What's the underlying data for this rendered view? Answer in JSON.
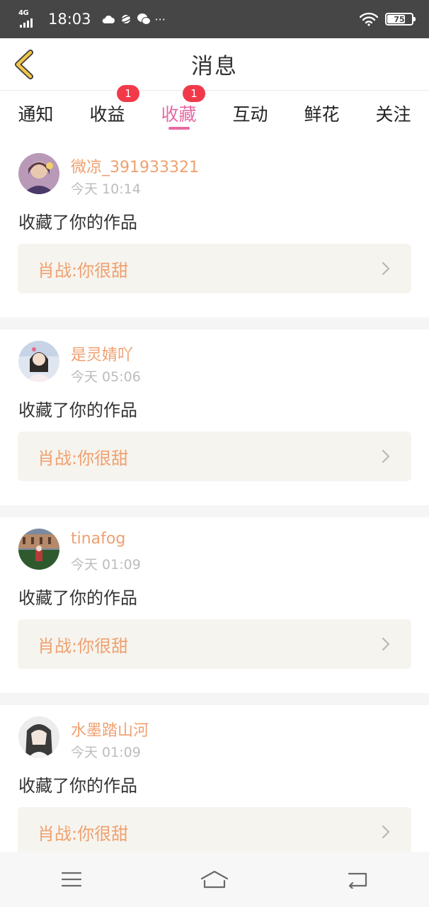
{
  "status_bar": {
    "network": "4G",
    "time": "18:03",
    "more": "···",
    "battery": "75",
    "battery_level": 0.75
  },
  "header": {
    "title": "消息"
  },
  "tabs": [
    {
      "label": "通知",
      "badge": null,
      "active": false
    },
    {
      "label": "收益",
      "badge": "1",
      "active": false
    },
    {
      "label": "收藏",
      "badge": "1",
      "active": true
    },
    {
      "label": "互动",
      "badge": null,
      "active": false
    },
    {
      "label": "鲜花",
      "badge": null,
      "active": false
    },
    {
      "label": "关注",
      "badge": null,
      "active": false
    }
  ],
  "messages": [
    {
      "user": "微凉_391933321",
      "time": "今天 10:14",
      "action": "收藏了你的作品",
      "work": "肖战:你很甜"
    },
    {
      "user": "是灵婧吖",
      "time": "今天 05:06",
      "action": "收藏了你的作品",
      "work": "肖战:你很甜"
    },
    {
      "user": "tinafog",
      "time": "今天 01:09",
      "action": "收藏了你的作品",
      "work": "肖战:你很甜"
    },
    {
      "user": "水墨踏山河",
      "time": "今天 01:09",
      "action": "收藏了你的作品",
      "work": "肖战:你很甜"
    }
  ],
  "colors": {
    "accent_pink": "#e66aa4",
    "username_orange": "#f0a070",
    "badge_red": "#f2394a",
    "back_arrow_yellow": "#f0c64a",
    "status_bar_bg": "#464646"
  },
  "icons": {
    "back": "chevron-left-icon",
    "item_arrow": "chevron-right-icon",
    "nav_menu": "menu-icon",
    "nav_home": "home-icon",
    "nav_back": "return-icon"
  }
}
